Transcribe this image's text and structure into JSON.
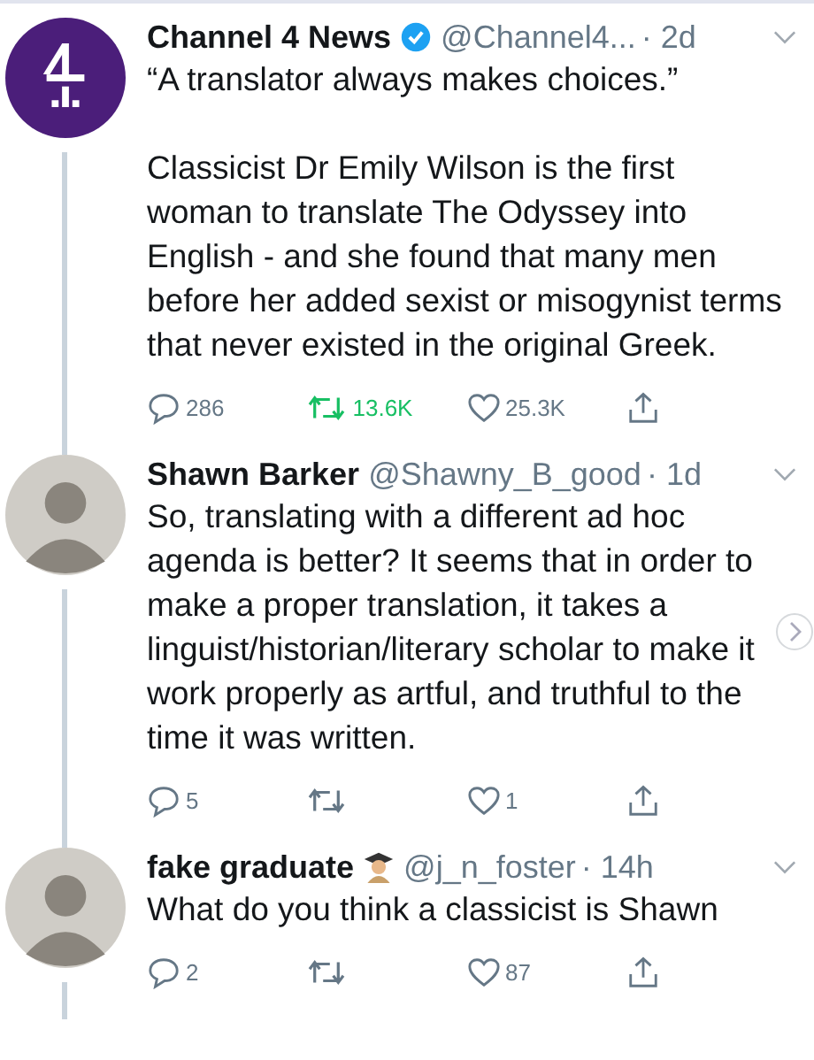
{
  "tweets": [
    {
      "kind": "logo",
      "name": "Channel 4 News",
      "verified": true,
      "name_badge": false,
      "handle": "@Channel4...",
      "time": "· 2d",
      "paragraphs": [
        "“A translator always makes choices.”",
        "Classicist Dr Emily Wilson is the first woman to translate The Odyssey into English - and she found that many men before her added sexist or misogynist terms that never existed in the original Greek."
      ],
      "replies": "286",
      "retweets": "13.6K",
      "retweeted": true,
      "likes": "25.3K"
    },
    {
      "kind": "photo",
      "name": "Shawn Barker",
      "verified": false,
      "name_badge": false,
      "handle": "@Shawny_B_good",
      "time": "· 1d",
      "paragraphs": [
        "So, translating with a different ad hoc agenda is better? It seems that in order to make a proper translation, it takes a linguist/historian/literary scholar to make it work properly as artful, and truthful to the time it was written."
      ],
      "replies": "5",
      "retweeted": false,
      "likes": "1"
    },
    {
      "kind": "photo",
      "name": "fake graduate",
      "verified": false,
      "name_badge": true,
      "handle": "@j_n_foster",
      "time": "· 14h",
      "paragraphs": [
        "What do you think a classicist is Shawn"
      ],
      "replies": "2",
      "retweeted": false,
      "likes": "87"
    }
  ]
}
